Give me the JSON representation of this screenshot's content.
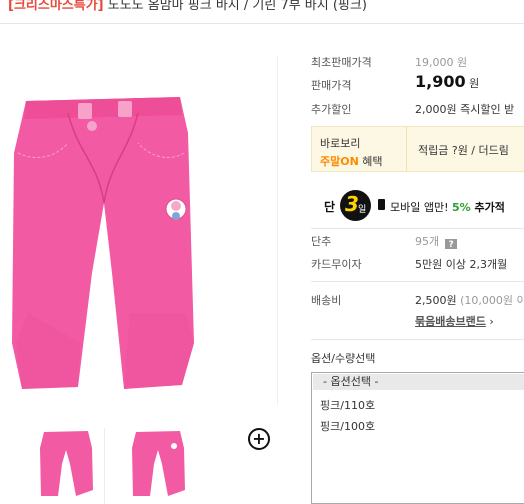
{
  "header": {
    "tag": "[크리스마스특가]",
    "title": "노노노 옴맘마 핑크 바지 / 기린 7부 바지 (핑크)"
  },
  "gallery": {
    "zoom_icon": "zoom-plus-icon",
    "thumbnails": [
      {
        "name": "thumbnail-1",
        "color": "#f0509a"
      },
      {
        "name": "thumbnail-2",
        "color": "#f0509a"
      }
    ]
  },
  "product": {
    "min_price_label": "최초판매가격",
    "min_price_value": "19,000 원",
    "sale_price_label": "판매가격",
    "sale_price_value": "1,900",
    "sale_price_unit": "원",
    "extra_discount_label": "추가할인",
    "extra_discount_value": "2,000원 즉시할인 받",
    "benefit": {
      "line1": "바로보리",
      "line2_highlight": "주말ON",
      "line2_rest": " 혜택",
      "right_text": "적립금 ?원 / 더드림"
    },
    "mobile": {
      "prefix": "단",
      "days": "3",
      "days_unit": "일",
      "text": "모바일 앱만! ",
      "pct": "5%",
      "more": " 추가적"
    },
    "unit_label": "단추",
    "unit_value": "95개",
    "card_label": "카드무이자",
    "card_value": "5만원 이상 2,3개월",
    "shipping_label": "배송비",
    "shipping_value": "2,500원",
    "shipping_note": " (10,000원 이",
    "shipping_brand": "묶음배송브랜드",
    "shipping_brand_arrow": "›"
  },
  "options": {
    "title": "옵션/수량선택",
    "placeholder": "- 옵션선택 -",
    "items": [
      "핑크/110호",
      "핑크/100호"
    ]
  },
  "colors": {
    "pants": "#f25aa3",
    "accent_orange": "#ff8a00",
    "accent_green": "#2da12d",
    "tag_red": "#e8483b",
    "badge_yellow": "#ffd200"
  }
}
